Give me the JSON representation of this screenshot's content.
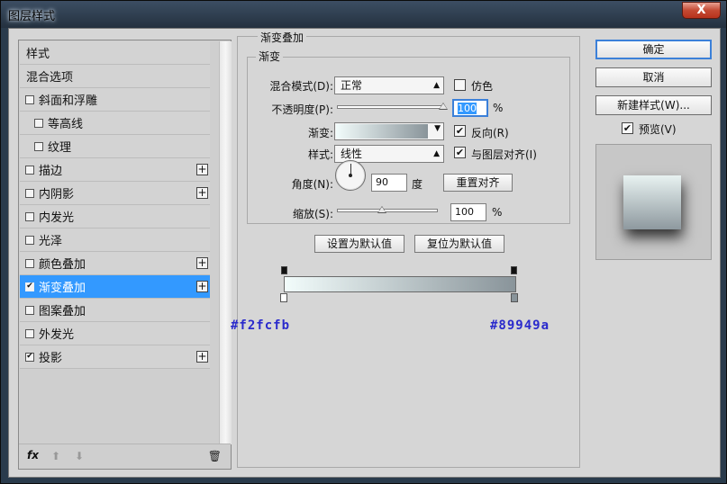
{
  "window": {
    "title": "图层样式",
    "close_glyph": "X"
  },
  "left_panel": {
    "items": [
      {
        "label": "样式",
        "checkbox": false,
        "checked": false,
        "plus": false,
        "indent": 0,
        "active": false
      },
      {
        "label": "混合选项",
        "checkbox": false,
        "checked": false,
        "plus": false,
        "indent": 0,
        "active": false
      },
      {
        "label": "斜面和浮雕",
        "checkbox": true,
        "checked": false,
        "plus": false,
        "indent": 0,
        "active": false
      },
      {
        "label": "等高线",
        "checkbox": true,
        "checked": false,
        "plus": false,
        "indent": 1,
        "active": false
      },
      {
        "label": "纹理",
        "checkbox": true,
        "checked": false,
        "plus": false,
        "indent": 1,
        "active": false
      },
      {
        "label": "描边",
        "checkbox": true,
        "checked": false,
        "plus": true,
        "indent": 0,
        "active": false
      },
      {
        "label": "内阴影",
        "checkbox": true,
        "checked": false,
        "plus": true,
        "indent": 0,
        "active": false
      },
      {
        "label": "内发光",
        "checkbox": true,
        "checked": false,
        "plus": false,
        "indent": 0,
        "active": false
      },
      {
        "label": "光泽",
        "checkbox": true,
        "checked": false,
        "plus": false,
        "indent": 0,
        "active": false
      },
      {
        "label": "颜色叠加",
        "checkbox": true,
        "checked": false,
        "plus": true,
        "indent": 0,
        "active": false
      },
      {
        "label": "渐变叠加",
        "checkbox": true,
        "checked": true,
        "plus": true,
        "indent": 0,
        "active": true
      },
      {
        "label": "图案叠加",
        "checkbox": true,
        "checked": false,
        "plus": false,
        "indent": 0,
        "active": false
      },
      {
        "label": "外发光",
        "checkbox": true,
        "checked": false,
        "plus": false,
        "indent": 0,
        "active": false
      },
      {
        "label": "投影",
        "checkbox": true,
        "checked": true,
        "plus": true,
        "indent": 0,
        "active": false
      }
    ],
    "footer": {
      "fx_label": "fx",
      "move_up_glyph": "⬆",
      "move_down_glyph": "⬇",
      "delete_glyph": "🗑"
    }
  },
  "gradient_overlay": {
    "section_title": "渐变叠加",
    "subsection_title": "渐变",
    "blend_mode_label": "混合模式(D):",
    "blend_mode_value": "正常",
    "dither_label": "仿色",
    "dither_checked": false,
    "opacity_label": "不透明度(P):",
    "opacity_value": "100",
    "opacity_unit": "%",
    "opacity_fraction": 1.0,
    "gradient_label": "渐变:",
    "reverse_label": "反向(R)",
    "reverse_checked": true,
    "style_label": "样式:",
    "style_value": "线性",
    "align_label": "与图层对齐(I)",
    "align_checked": true,
    "angle_label": "角度(N):",
    "angle_value": "90",
    "angle_unit": "度",
    "reset_align_button": "重置对齐",
    "scale_label": "缩放(S):",
    "scale_value": "100",
    "scale_unit": "%",
    "scale_fraction": 0.45,
    "set_default_button": "设置为默认值",
    "reset_default_button": "复位为默认值"
  },
  "gradient_stops": {
    "start_hex": "#f2fcfb",
    "end_hex": "#89949a"
  },
  "right_panel": {
    "ok_button": "确定",
    "cancel_button": "取消",
    "new_style_button": "新建样式(W)...",
    "preview_label": "预览(V)",
    "preview_checked": true
  },
  "colors": {
    "accent": "#3399ff",
    "gradient_start": "#f2fcfb",
    "gradient_end": "#89949a",
    "hex_text": "#2a2acc"
  }
}
